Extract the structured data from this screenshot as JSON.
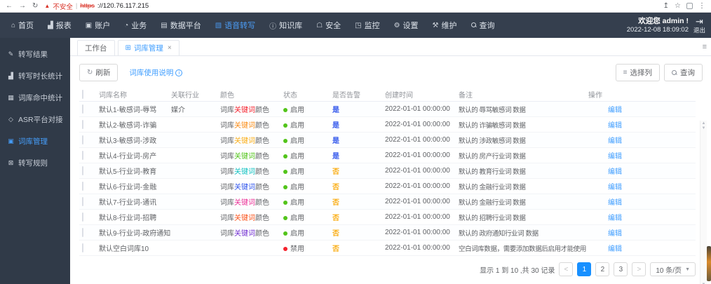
{
  "browser": {
    "security_warning": "不安全",
    "url_scheme": "https",
    "url_host": "://120.76.117.215"
  },
  "topnav": {
    "items": [
      {
        "label": "首页",
        "icon": "home-icon",
        "active": false
      },
      {
        "label": "报表",
        "icon": "report-icon",
        "active": false
      },
      {
        "label": "账户",
        "icon": "account-icon",
        "active": false
      },
      {
        "label": "业务",
        "icon": "business-icon",
        "active": false
      },
      {
        "label": "数据平台",
        "icon": "data-platform-icon",
        "active": false
      },
      {
        "label": "语音转写",
        "icon": "speech-transcribe-icon",
        "active": true
      },
      {
        "label": "知识库",
        "icon": "knowledge-icon",
        "active": false
      },
      {
        "label": "安全",
        "icon": "security-icon",
        "active": false
      },
      {
        "label": "监控",
        "icon": "monitor-icon",
        "active": false
      },
      {
        "label": "设置",
        "icon": "settings-icon",
        "active": false
      },
      {
        "label": "维护",
        "icon": "maintenance-icon",
        "active": false
      },
      {
        "label": "查询",
        "icon": "search-icon",
        "active": false
      }
    ],
    "welcome": "欢迎您 admin !",
    "datetime": "2022-12-08 18:09:02",
    "logout_label": "退出"
  },
  "sidebar": {
    "items": [
      {
        "label": "转写结果",
        "icon": "transcribe-result-icon",
        "active": false
      },
      {
        "label": "转写时长统计",
        "icon": "duration-stats-icon",
        "active": false
      },
      {
        "label": "词库命中统计",
        "icon": "lexicon-hit-stats-icon",
        "active": false
      },
      {
        "label": "ASR平台对接",
        "icon": "asr-platform-icon",
        "active": false
      },
      {
        "label": "词库管理",
        "icon": "lexicon-manage-icon",
        "active": true
      },
      {
        "label": "转写规则",
        "icon": "transcribe-rules-icon",
        "active": false
      }
    ]
  },
  "tabs": [
    {
      "label": "工作台",
      "active": false,
      "closable": false
    },
    {
      "label": "词库管理",
      "active": true,
      "closable": true,
      "icon": "grid-icon"
    }
  ],
  "toolbar": {
    "refresh_label": "刷新",
    "help_label": "词库使用说明",
    "select_columns_label": "选择列",
    "search_label": "查询"
  },
  "table": {
    "headers": [
      "词库名称",
      "关联行业",
      "颜色",
      "状态",
      "是否告警",
      "创建时间",
      "备注",
      "操作"
    ],
    "color_cell_text": {
      "prefix": "词库",
      "keyword": "关键词",
      "suffix": "颜色"
    },
    "status_colors": {
      "enabled": "#52c41a",
      "disabled": "#f5222d"
    },
    "rows": [
      {
        "name": "默认1-敏感词-辱骂",
        "industry": "媒介",
        "keyword_color": "#f5222d",
        "status": "启用",
        "enabled": true,
        "alert": "是",
        "created": "2022-01-01 00:00:00",
        "remark": "默认的 辱骂敏感词 数据",
        "action": "编辑"
      },
      {
        "name": "默认2-敏感词-诈骗",
        "industry": "",
        "keyword_color": "#fa8c16",
        "status": "启用",
        "enabled": true,
        "alert": "是",
        "created": "2022-01-01 00:00:00",
        "remark": "默认的 诈骗敏感词 数据",
        "action": "编辑"
      },
      {
        "name": "默认3-敏感词-涉政",
        "industry": "",
        "keyword_color": "#faad14",
        "status": "启用",
        "enabled": true,
        "alert": "是",
        "created": "2022-01-01 00:00:00",
        "remark": "默认的 涉政敏感词 数据",
        "action": "编辑"
      },
      {
        "name": "默认4-行业词-房产",
        "industry": "",
        "keyword_color": "#52c41a",
        "status": "启用",
        "enabled": true,
        "alert": "是",
        "created": "2022-01-01 00:00:00",
        "remark": "默认的 房产行业词 数据",
        "action": "编辑"
      },
      {
        "name": "默认5-行业词-教育",
        "industry": "",
        "keyword_color": "#13c2c2",
        "status": "启用",
        "enabled": true,
        "alert": "否",
        "created": "2022-01-01 00:00:00",
        "remark": "默认的 教育行业词 数据",
        "action": "编辑"
      },
      {
        "name": "默认6-行业词-金融",
        "industry": "",
        "keyword_color": "#2f54eb",
        "status": "启用",
        "enabled": true,
        "alert": "否",
        "created": "2022-01-01 00:00:00",
        "remark": "默认的 金融行业词 数据",
        "action": "编辑"
      },
      {
        "name": "默认7-行业词-通讯",
        "industry": "",
        "keyword_color": "#eb2f96",
        "status": "启用",
        "enabled": true,
        "alert": "否",
        "created": "2022-01-01 00:00:00",
        "remark": "默认的 金融行业词 数据",
        "action": "编辑"
      },
      {
        "name": "默认8-行业词-招聘",
        "industry": "",
        "keyword_color": "#fa541c",
        "status": "启用",
        "enabled": true,
        "alert": "否",
        "created": "2022-01-01 00:00:00",
        "remark": "默认的 招聘行业词 数据",
        "action": "编辑"
      },
      {
        "name": "默认9-行业词-政府通知",
        "industry": "",
        "keyword_color": "#722ed1",
        "status": "启用",
        "enabled": true,
        "alert": "否",
        "created": "2022-01-01 00:00:00",
        "remark": "默认的 政府通知行业词 数据",
        "action": "编辑"
      },
      {
        "name": "默认空白词库10",
        "industry": "",
        "keyword_color": null,
        "status": "禁用",
        "enabled": false,
        "alert": "否",
        "created": "2022-01-01 00:00:00",
        "remark": "空白词库数据，需要添加数据后启用才能使用",
        "action": "编辑"
      }
    ]
  },
  "pagination": {
    "summary": "显示 1 到 10 ,共 30 记录",
    "prev": "<",
    "pages": [
      "1",
      "2",
      "3"
    ],
    "active_page": "1",
    "next": ">",
    "page_size": "10 条/页"
  },
  "colors": {
    "accent_blue": "#409eff",
    "active_page_blue": "#1890ff",
    "alert_yes_blue": "#2f54eb",
    "alert_no_orange": "#faad14",
    "nav_dark": "#353f4e",
    "sidebar_dark": "#303a48",
    "enabled_green": "#52c41a",
    "disabled_red": "#f5222d"
  }
}
